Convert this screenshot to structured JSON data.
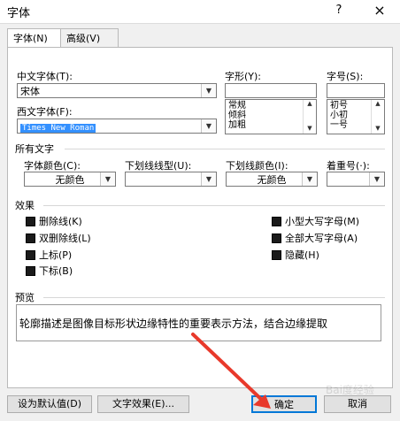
{
  "window": {
    "title": "字体",
    "help_label": "?",
    "close_label": "×"
  },
  "tabs": [
    {
      "label": "字体(N)",
      "active": true
    },
    {
      "label": "高级(V)",
      "active": false
    }
  ],
  "font": {
    "chinese_label": "中文字体(T):",
    "chinese_value": "宋体",
    "western_label": "西文字体(F):",
    "western_value": "Times New Roman",
    "style_label": "字形(Y):",
    "style_value": "",
    "style_options": [
      "常规",
      "倾斜",
      "加粗"
    ],
    "size_label": "字号(S):",
    "size_value": "",
    "size_options": [
      "初号",
      "小初",
      "一号"
    ]
  },
  "all_text": {
    "section_label": "所有文字",
    "font_color_label": "字体颜色(C):",
    "font_color_value": "无颜色",
    "underline_type_label": "下划线线型(U):",
    "underline_type_value": "",
    "underline_color_label": "下划线颜色(I):",
    "underline_color_value": "无颜色",
    "emphasis_label": "着重号(·):",
    "emphasis_value": ""
  },
  "effects": {
    "section_label": "效果",
    "left": [
      {
        "label": "删除线(K)",
        "checked": true
      },
      {
        "label": "双删除线(L)",
        "checked": true
      },
      {
        "label": "上标(P)",
        "checked": true
      },
      {
        "label": "下标(B)",
        "checked": true
      }
    ],
    "right": [
      {
        "label": "小型大写字母(M)",
        "checked": true
      },
      {
        "label": "全部大写字母(A)",
        "checked": true
      },
      {
        "label": "隐藏(H)",
        "checked": true
      }
    ]
  },
  "preview": {
    "section_label": "预览",
    "text": "轮廓描述是图像目标形状边缘特性的重要表示方法，结合边缘提取"
  },
  "buttons": {
    "default_label": "设为默认值(D)",
    "text_effects_label": "文字效果(E)...",
    "ok_label": "确定",
    "cancel_label": "取消"
  },
  "colors": {
    "accent": "#0078d7",
    "arrow": "#e8392b"
  },
  "watermark": "Bai度经验"
}
